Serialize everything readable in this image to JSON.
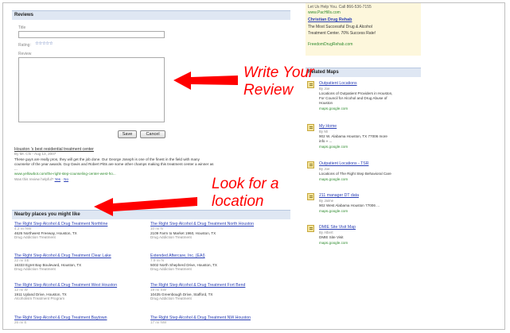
{
  "reviews": {
    "header": "Reviews",
    "title_label": "Title",
    "rating_label": "Rating:",
    "rating_stars": "☆☆☆☆☆",
    "review_label": "Review",
    "save_label": "Save",
    "cancel_label": "Cancel"
  },
  "existing_review": {
    "title": "Houston 's best residential treatment center",
    "byline": "By Mr. Chi - Aug 13, 2007",
    "body": [
      "These guys are really pros, they will get the job done. Our George Joseph is one of the finest in the field with many",
      "counselor of the year awards. Guy Davis and Robert Pitts are some other champs making this treatment center a winner as"
    ],
    "ellipsis": "...",
    "url": "www.yellowbot.com/the-right-step-counseling-center-west-ho...",
    "helpful_text": "Was this review helpful?",
    "yes": "Yes",
    "no": "No"
  },
  "nearby": {
    "header": "Nearby places you might like",
    "places": [
      {
        "name": "The Right Step Alcohol & Drug Treatment Northline",
        "dist": "4.2 mi NW",
        "addr": "4626 Northwest Freeway, Houston, TX",
        "cat": "Drug Addiction Treatment"
      },
      {
        "name": "The Right Step Alcohol & Drug Treatment North Houston",
        "dist": "10 mi N",
        "addr": "2109 Farm to Market 1960, Houston, TX",
        "cat": "Drug Addiction Treatment"
      },
      {
        "name": "The Right Step Alcohol & Drug Treatment Clear Lake",
        "dist": "22 mi SE",
        "addr": "16333 Egret Bay Boulevard, Houston, TX",
        "cat": "Drug Addiction Treatment"
      },
      {
        "name": "Extended Aftercare, Inc. (EAI)",
        "dist": "7.9 mi N",
        "addr": "5002 North Shepherd Drive, Houston, TX",
        "cat": "Drug Addiction Treatment"
      },
      {
        "name": "The Right Step Alcohol & Drug Treatment West Houston",
        "dist": "12 mi W",
        "addr": "1911 Upland Drive, Houston, TX",
        "cat": "Alcoholism Treatment Program"
      },
      {
        "name": "The Right Step Alcohol & Drug Treatment Fort Bend",
        "dist": "19 mi SW",
        "addr": "10435 Greenbough Drive, Stafford, TX",
        "cat": "Drug Addiction Treatment"
      },
      {
        "name": "The Right Step Alcohol & Drug Treatment Baytown",
        "dist": "26 mi E",
        "addr": "",
        "cat": ""
      },
      {
        "name": "The Right Step Alcohol & Drug Treatment NW Houston",
        "dist": "17 mi NW",
        "addr": "",
        "cat": ""
      }
    ]
  },
  "ad": {
    "line1": "Let Us Help You. Call 866-536-7155",
    "line1b": "www.PacHills.com",
    "title": "Christian Drug Rehab",
    "line2": "The Most Successful Drug & Alcohol",
    "line3": "Treatment Center. 70% Success Rate!",
    "url": "FreedomDrugRehab.com"
  },
  "related_maps": {
    "header": "Related Maps",
    "items": [
      {
        "title": "Outpatient Locations",
        "by": "By Joe",
        "desc": [
          "Locations of Outpatient Providers in Houston,",
          "For Council for Alcohol and Drug Abuse of",
          "Houston"
        ],
        "url": "maps.google.com"
      },
      {
        "title": "My Home",
        "by": "By Mi",
        "desc": [
          "902 W. Alabama Houston, TX 77006 more",
          "info » ..."
        ],
        "url": "maps.google.com"
      },
      {
        "title": "Outpatient Locations - TSR",
        "by": "By Joe",
        "desc": [
          "Locations of The Right Step Behavioral Care"
        ],
        "url": "maps.google.com"
      },
      {
        "title": "211 manager DT data",
        "by": "By Jaime",
        "desc": [
          "902 West Alabama Houston 77006 ..."
        ],
        "url": "maps.google.com"
      },
      {
        "title": "DMIE Site Visit Map",
        "by": "By Albert",
        "desc": [
          "DMIE Site Visit"
        ],
        "url": "maps.google.com"
      }
    ]
  },
  "annotations": {
    "write_review": [
      "Write Your",
      "Review"
    ],
    "look_location": [
      "Look for a",
      "location"
    ],
    "arrow_color": "#ff0000"
  }
}
